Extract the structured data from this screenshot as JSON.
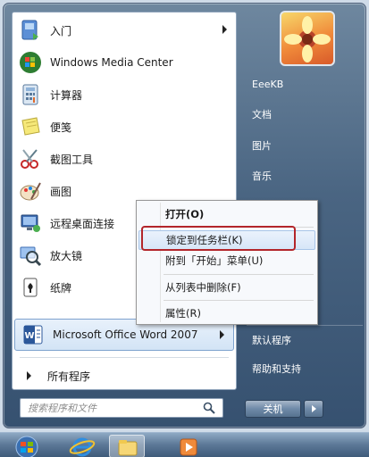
{
  "left_pane": {
    "items": [
      {
        "label": "入门",
        "icon": "getting-started-icon",
        "has_arrow": true
      },
      {
        "label": "Windows Media Center",
        "icon": "windows-media-center-icon",
        "has_arrow": false
      },
      {
        "label": "计算器",
        "icon": "calculator-icon",
        "has_arrow": false
      },
      {
        "label": "便笺",
        "icon": "sticky-notes-icon",
        "has_arrow": false
      },
      {
        "label": "截图工具",
        "icon": "snipping-tool-icon",
        "has_arrow": false
      },
      {
        "label": "画图",
        "icon": "paint-icon",
        "has_arrow": false
      },
      {
        "label": "远程桌面连接",
        "icon": "remote-desktop-icon",
        "has_arrow": false
      },
      {
        "label": "放大镜",
        "icon": "magnifier-icon",
        "has_arrow": false
      },
      {
        "label": "纸牌",
        "icon": "solitaire-icon",
        "has_arrow": false
      },
      {
        "label": "Microsoft Office Word 2007",
        "icon": "word-icon",
        "has_arrow": true
      }
    ],
    "all_programs": "所有程序",
    "search_placeholder": "搜索程序和文件"
  },
  "right_pane": {
    "items": [
      "EeeKB",
      "文档",
      "图片",
      "音乐",
      "默认程序",
      "帮助和支持"
    ],
    "shutdown_label": "关机"
  },
  "context_menu": {
    "items": [
      {
        "label": "打开(O)",
        "bold": true
      },
      {
        "label": "锁定到任务栏(K)",
        "highlighted": true
      },
      {
        "label": "附到「开始」菜单(U)"
      },
      {
        "label": "从列表中删除(F)"
      },
      {
        "label": "属性(R)"
      }
    ]
  },
  "colors": {
    "highlight_border": "#b3252a",
    "menu_background": "#4a6582",
    "left_pane_background": "#ffffff"
  }
}
